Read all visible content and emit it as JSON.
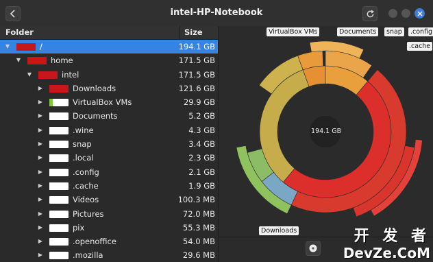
{
  "window": {
    "title": "intel-HP-Notebook",
    "back_icon": "chevron-left-icon",
    "refresh_icon": "refresh-icon",
    "close_icon": "close-icon"
  },
  "tree": {
    "header": {
      "folder": "Folder",
      "size": "Size"
    },
    "rows": [
      {
        "name": "/",
        "size": "194.1 GB",
        "depth": 0,
        "expanded": true,
        "selected": true,
        "swatch": "#c8171b",
        "fill": 1.0
      },
      {
        "name": "home",
        "size": "171.5 GB",
        "depth": 1,
        "expanded": true,
        "selected": false,
        "swatch": "#c8171b",
        "fill": 0.88
      },
      {
        "name": "intel",
        "size": "171.5 GB",
        "depth": 2,
        "expanded": true,
        "selected": false,
        "swatch": "#c8171b",
        "fill": 1.0
      },
      {
        "name": "Downloads",
        "size": "121.6 GB",
        "depth": 3,
        "expanded": false,
        "selected": false,
        "swatch": "#c8171b",
        "fill": 0.71
      },
      {
        "name": "VirtualBox VMs",
        "size": "29.9 GB",
        "depth": 3,
        "expanded": false,
        "selected": false,
        "swatch": "#7ec83a",
        "fill": 0.17
      },
      {
        "name": "Documents",
        "size": "5.2 GB",
        "depth": 3,
        "expanded": false,
        "selected": false,
        "swatch": "#ffffff",
        "fill": 0.03
      },
      {
        "name": ".wine",
        "size": "4.3 GB",
        "depth": 3,
        "expanded": false,
        "selected": false,
        "swatch": "#ffffff",
        "fill": 0.03
      },
      {
        "name": "snap",
        "size": "3.4 GB",
        "depth": 3,
        "expanded": false,
        "selected": false,
        "swatch": "#ffffff",
        "fill": 0.02
      },
      {
        "name": ".local",
        "size": "2.3 GB",
        "depth": 3,
        "expanded": false,
        "selected": false,
        "swatch": "#ffffff",
        "fill": 0.01
      },
      {
        "name": ".config",
        "size": "2.1 GB",
        "depth": 3,
        "expanded": false,
        "selected": false,
        "swatch": "#ffffff",
        "fill": 0.01
      },
      {
        "name": ".cache",
        "size": "1.9 GB",
        "depth": 3,
        "expanded": false,
        "selected": false,
        "swatch": "#ffffff",
        "fill": 0.01
      },
      {
        "name": "Videos",
        "size": "100.3 MB",
        "depth": 3,
        "expanded": false,
        "selected": false,
        "swatch": "#ffffff",
        "fill": 0.0
      },
      {
        "name": "Pictures",
        "size": "72.0 MB",
        "depth": 3,
        "expanded": false,
        "selected": false,
        "swatch": "#ffffff",
        "fill": 0.0
      },
      {
        "name": "pix",
        "size": "55.3 MB",
        "depth": 3,
        "expanded": false,
        "selected": false,
        "swatch": "#ffffff",
        "fill": 0.0
      },
      {
        "name": ".openoffice",
        "size": "54.0 MB",
        "depth": 3,
        "expanded": false,
        "selected": false,
        "swatch": "#ffffff",
        "fill": 0.0
      },
      {
        "name": ".mozilla",
        "size": "29.6 MB",
        "depth": 3,
        "expanded": false,
        "selected": false,
        "swatch": "#ffffff",
        "fill": 0.0
      }
    ]
  },
  "chart": {
    "center_label": "194.1 GB",
    "tags": {
      "virtualbox": "VirtualBox VMs",
      "documents": "Documents",
      "snap": "snap",
      "config": ".config",
      "cache": ".cache",
      "downloads": "Downloads"
    },
    "colors": {
      "downloads": "#e0302b",
      "virtualbox": "#c8b24e",
      "documents": "#e58a32",
      "root": "#d92a28"
    }
  },
  "bottom": {
    "icon": "disk-icon"
  },
  "watermark": {
    "line1": "开 发 者",
    "line2": "DevZe.CoM"
  }
}
